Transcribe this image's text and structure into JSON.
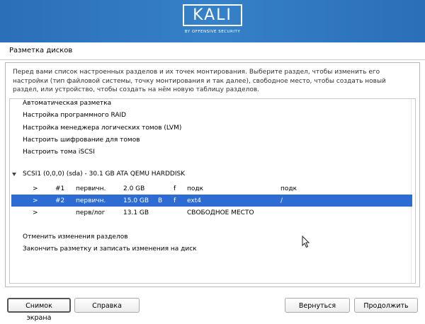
{
  "banner": {
    "logo_text": "KALI",
    "logo_subtext": "BY OFFENSIVE SECURITY"
  },
  "window": {
    "title": "Разметка дисков"
  },
  "description": "Перед вами список настроенных разделов и их точек монтирования. Выберите раздел, чтобы изменить его настройки (тип файловой системы, точку монтирования и так далее), свободное место, чтобы создать новый раздел, или устройство, чтобы создать на нём новую таблицу разделов.",
  "menu_items": [
    "Автоматическая разметка",
    "Настройка программного RAID",
    "Настройка менеджера логических томов (LVM)",
    "Настроить шифрование для томов",
    "Настроить тома iSCSI"
  ],
  "disk": {
    "label": "SCSI1 (0,0,0) (sda) - 30.1 GB ATA QEMU HARDDISK",
    "partitions": [
      {
        "arrow": ">",
        "num": "#1",
        "type": "первичн.",
        "size": "2.0 GB",
        "bootable": "",
        "format": "f",
        "fs": "подк",
        "mount": "подк"
      },
      {
        "arrow": ">",
        "num": "#2",
        "type": "первичн.",
        "size": "15.0 GB",
        "bootable": "B",
        "format": "f",
        "fs": "ext4",
        "mount": "/"
      },
      {
        "arrow": ">",
        "num": "",
        "type": "перв/лог",
        "size": "13.1 GB",
        "bootable": "",
        "format": "",
        "fs": "СВОБОДНОЕ МЕСТО",
        "mount": ""
      }
    ]
  },
  "actions": [
    "Отменить изменения разделов",
    "Закончить разметку и записать изменения на диск"
  ],
  "buttons": {
    "screenshot": "Снимок экрана",
    "help": "Справка",
    "back": "Вернуться",
    "continue": "Продолжить"
  },
  "colors": {
    "banner": "#3681c8",
    "selection": "#2c6cd3"
  }
}
